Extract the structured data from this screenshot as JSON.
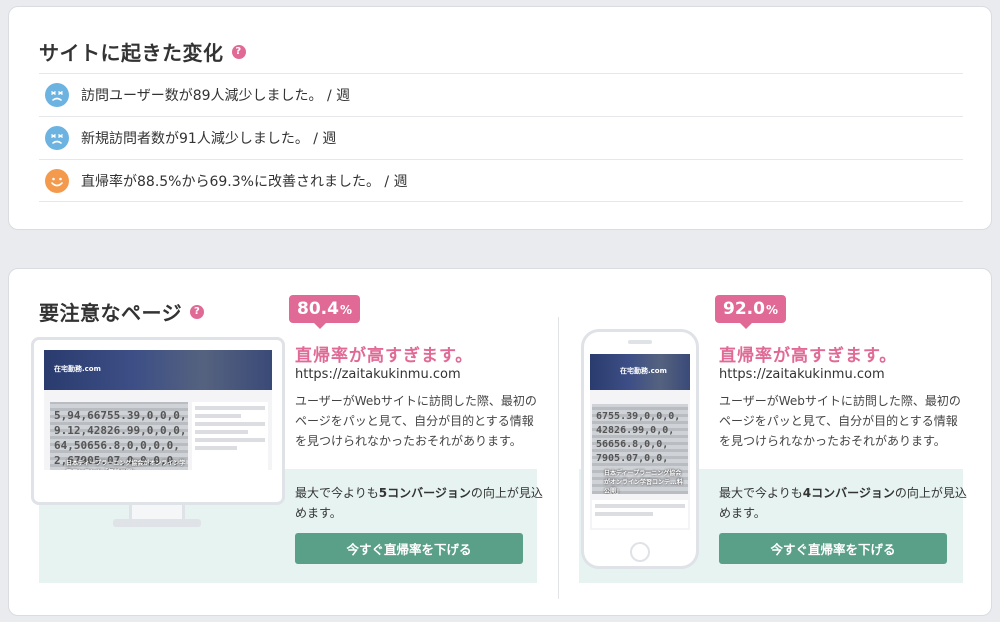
{
  "changes_card": {
    "title": "サイトに起きた変化",
    "help": "?",
    "items": [
      {
        "icon": "sad-face-icon",
        "text": "訪問ユーザー数が89人減少しました。 / 週"
      },
      {
        "icon": "sad-face-icon",
        "text": "新規訪問者数が91人減少しました。 / 週"
      },
      {
        "icon": "happy-face-icon",
        "text": "直帰率が88.5%から69.3%に改善されました。 / 週"
      }
    ]
  },
  "pages_card": {
    "title": "要注意なページ",
    "help": "?",
    "pages": [
      {
        "device": "desktop",
        "rate": "80.4",
        "rate_unit": "%",
        "alert": "直帰率が高すぎます。",
        "url": "https://zaitakukinmu.com",
        "description": "ユーザーがWebサイトに訪問した際、最初のページをパッと見て、自分が目的とする情報を見つけられなかったおそれがあります。",
        "cta_prefix": "最大で今よりも",
        "cta_highlight": "5コンバージョン",
        "cta_suffix": "の向上が見込めます。",
        "button": "今すぐ直帰率を下げる",
        "preview": {
          "logo": "在宅勤務.com",
          "caption": "日本ディープラーニング協会がオンライン学習コンテンツ「無料公開」",
          "digits": [
            "5,94,66755.39,0,0,0,",
            "9.12,42826.99,0,0,0,",
            "64,50656.8,0,0,0,0,",
            "2,67905.07,0,0,0,0,"
          ]
        }
      },
      {
        "device": "mobile",
        "rate": "92.0",
        "rate_unit": "%",
        "alert": "直帰率が高すぎます。",
        "url": "https://zaitakukinmu.com",
        "description": "ユーザーがWebサイトに訪問した際、最初のページをパッと見て、自分が目的とする情報を見つけられなかったおそれがあります。",
        "cta_prefix": "最大で今よりも",
        "cta_highlight": "4コンバージョン",
        "cta_suffix": "の向上が見込めます。",
        "button": "今すぐ直帰率を下げる",
        "preview": {
          "logo": "在宅勤務.com",
          "caption": "日本ディープラーニング協会がオンライン学習コンテ...料公開」",
          "digits": [
            "6755.39,0,0,0,",
            "42826.99,0,0,",
            "56656.8,0,0,",
            "7905.07,0,0,"
          ]
        }
      }
    ]
  },
  "colors": {
    "accent": "#e06a95",
    "button": "#5a9f88",
    "cta_bg": "#e7f3f1",
    "sad": "#6cb3e2",
    "happy": "#f39a4d"
  }
}
